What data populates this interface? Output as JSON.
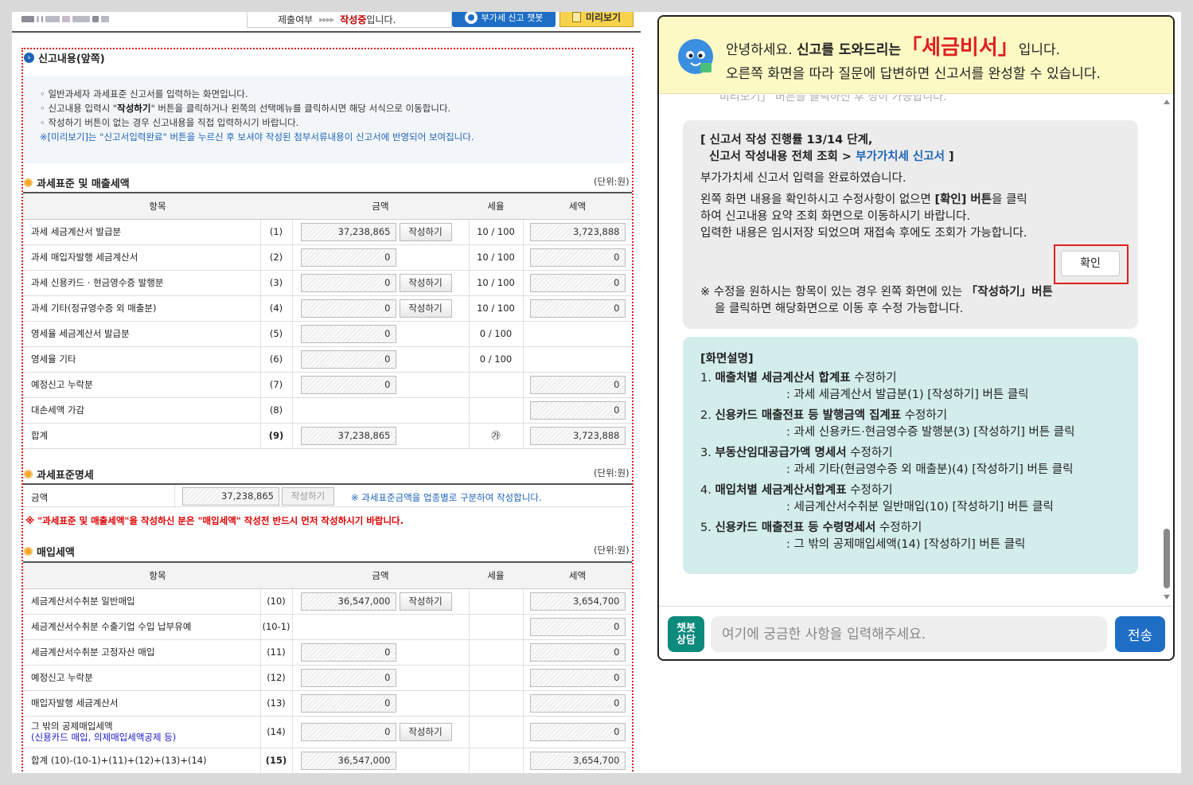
{
  "topbar": {
    "submit_label": "제출여부",
    "arrows": "▸▸▸▸",
    "status_prefix": "작성중",
    "status_suffix": "입니다.",
    "chatbot_button": "부가세 신고 챗봇",
    "preview_button": "미리보기"
  },
  "report": {
    "section_title": "신고내용(앞쪽)",
    "info_lines": [
      "◦ 일반과세자 과세표준 신고서를 입력하는 화면입니다.",
      "◦ 작성하기 버튼이 없는 경우 신고내용을 직접 입력하시기 바랍니다."
    ],
    "info_line2_pre": "◦ 신고내용 입력시 \"",
    "info_line2_bold": "작성하기",
    "info_line2_post": "\" 버튼을 클릭하거나 왼쪽의 선택메뉴를 클릭하시면 해당 서식으로 이동합니다.",
    "info_note": "※[미리보기]는 \"신고서입력완료\" 버튼을 누르신 후 보셔야 작성된 첨부서류내용이 신고서에 반영되어 보여집니다."
  },
  "sales": {
    "title": "과세표준 및 매출세액",
    "unit": "(단위:원)",
    "headers": [
      "항목",
      "금액",
      "세율",
      "세액"
    ],
    "rows": [
      {
        "name": "과세 세금계산서 발급분",
        "no": "(1)",
        "amount": "37,238,865",
        "btn": "작성하기",
        "rate": "10 / 100",
        "tax": "3,723,888"
      },
      {
        "name": "과세 매입자발행 세금계산서",
        "no": "(2)",
        "amount": "0",
        "btn": "",
        "rate": "10 / 100",
        "tax": "0"
      },
      {
        "name": "과세 신용카드 · 현금영수증 발행분",
        "no": "(3)",
        "amount": "0",
        "btn": "작성하기",
        "rate": "10 / 100",
        "tax": "0"
      },
      {
        "name": "과세 기타(정규영수증 외 매출분)",
        "no": "(4)",
        "amount": "0",
        "btn": "작성하기",
        "rate": "10 / 100",
        "tax": "0"
      },
      {
        "name": "영세율 세금계산서 발급분",
        "no": "(5)",
        "amount": "0",
        "btn": "",
        "rate": "0 / 100",
        "tax": ""
      },
      {
        "name": "영세율 기타",
        "no": "(6)",
        "amount": "0",
        "btn": "",
        "rate": "0 / 100",
        "tax": ""
      },
      {
        "name": "예정신고 누락분",
        "no": "(7)",
        "amount": "0",
        "btn": "",
        "rate": "",
        "tax": "0"
      },
      {
        "name": "대손세액 가감",
        "no": "(8)",
        "amount": "",
        "btn": "",
        "rate": "",
        "tax": "0"
      },
      {
        "name": "합계",
        "no": "(9)",
        "amount": "37,238,865",
        "btn": "",
        "rate": "㉮",
        "tax": "3,723,888"
      }
    ]
  },
  "standard": {
    "title": "과세표준명세",
    "unit": "(단위:원)",
    "label": "금액",
    "amount": "37,238,865",
    "btn": "작성하기",
    "note": "※ 과세표준금액을 업종별로 구분하여 작성합니다."
  },
  "warning": "※ \"과세표준 및 매출세액\"을 작성하신 분은 \"매입세액\" 작성전 반드시 먼저 작성하시기 바랍니다.",
  "purchase": {
    "title": "매입세액",
    "unit": "(단위:원)",
    "headers": [
      "항목",
      "금액",
      "세율",
      "세액"
    ],
    "rows": [
      {
        "name": "세금계산서수취분 일반매입",
        "sub": "",
        "no": "(10)",
        "amount": "36,547,000",
        "btn": "작성하기",
        "tax": "3,654,700"
      },
      {
        "name": "세금계산서수취분 수출기업 수입 납부유예",
        "sub": "",
        "no": "(10-1)",
        "amount": "",
        "btn": "",
        "tax": "0"
      },
      {
        "name": "세금계산서수취분 고정자산 매입",
        "sub": "",
        "no": "(11)",
        "amount": "0",
        "btn": "",
        "tax": "0"
      },
      {
        "name": "예정신고 누락분",
        "sub": "",
        "no": "(12)",
        "amount": "0",
        "btn": "",
        "tax": "0"
      },
      {
        "name": "매입자발행 세금계산서",
        "sub": "",
        "no": "(13)",
        "amount": "0",
        "btn": "",
        "tax": "0"
      },
      {
        "name": "그 밖의 공제매입세액",
        "sub": "(신용카드 매입, 의제매입세액공제 등)",
        "no": "(14)",
        "amount": "0",
        "btn": "작성하기",
        "tax": "0"
      },
      {
        "name": "합계 (10)-(10-1)+(11)+(12)+(13)+(14)",
        "sub": "",
        "no": "(15)",
        "amount": "36,547,000",
        "btn": "",
        "tax": "3,654,700"
      }
    ]
  },
  "chat": {
    "greet_pre": "안녕하세요. ",
    "greet_bold": "신고를 도와드리는",
    "greet_name": "「세금비서」",
    "greet_post": "입니다.",
    "greet_line2": "오른쪽 화면을 따라 질문에 답변하면 신고서를 완성할 수 있습니다.",
    "cut_text": "미리보기」 버튼을 클릭하신 후 정이 가능합니다.",
    "progress_line1": "[ 신고서 작성 진행률 13/14 단계,",
    "progress_line2_pre": "신고서 작성내용 전체 조회 > ",
    "progress_line2_link": "부가가치세 신고서",
    "progress_line2_post": " ]",
    "done_msg": "부가가치세 신고서 입력을 완료하였습니다.",
    "confirm_pre": "왼쪽 화면 내용을 확인하시고 수정사항이 없으면 ",
    "confirm_bold": "[확인] 버튼",
    "confirm_post": "을 클릭",
    "confirm_line2": "하여 신고내용 요약 조회 화면으로 이동하시기 바랍니다.",
    "confirm_line3": "입력한 내용은 임시저장 되었으며 재접속 후에도 조회가 가능합니다.",
    "ok_button": "확인",
    "notice_pre": "※ 수정을 원하시는 항목이 있는 경우 왼쪽 화면에 있는 ",
    "notice_bold": "「작성하기」버튼",
    "notice_line2": "을 클릭하면 해당화면으로 이동 후 수정 가능합니다.",
    "screen_title": "[화면설명]",
    "screen_items": [
      {
        "num": "1. ",
        "bold": "매출처별 세금계산서 합계표",
        "rest": " 수정하기",
        "desc": ": 과세 세금계산서 발급분(1) [작성하기] 버튼 클릭"
      },
      {
        "num": "2. ",
        "bold": "신용카드 매출전표 등 발행금액 집계표",
        "rest": " 수정하기",
        "desc": ": 과세 신용카드·현금영수증 발행분(3) [작성하기] 버튼 클릭"
      },
      {
        "num": "3. ",
        "bold": "부동산임대공급가액 명세서",
        "rest": " 수정하기",
        "desc": ": 과세 기타(현금영수증 외 매출분)(4) [작성하기] 버튼 클릭"
      },
      {
        "num": "4. ",
        "bold": "매입처별 세금계산서합계표",
        "rest": " 수정하기",
        "desc": ": 세금계산서수취분 일반매입(10) [작성하기] 버튼 클릭"
      },
      {
        "num": "5. ",
        "bold": "신용카드 매출전표 등 수령명세서",
        "rest": " 수정하기",
        "desc": ": 그 밖의 공제매입세액(14) [작성하기] 버튼 클릭"
      }
    ],
    "badge_line1": "챗봇",
    "badge_line2": "상담",
    "input_placeholder": "여기에 궁금한 사항을 입력해주세요.",
    "send_button": "전송"
  }
}
